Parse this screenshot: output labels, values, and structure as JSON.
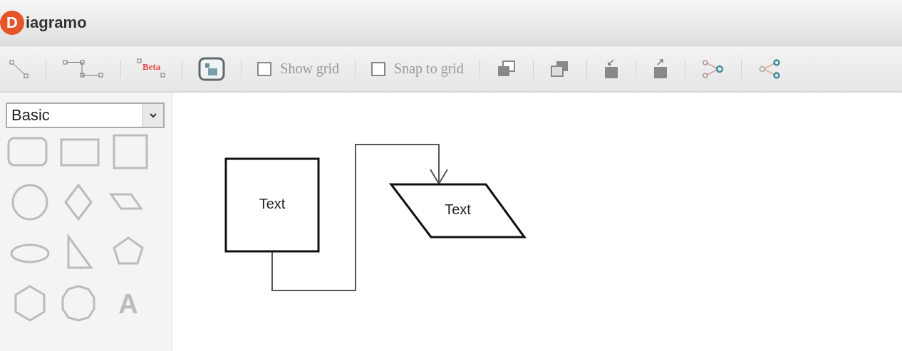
{
  "logo": {
    "initial": "D",
    "rest": "iagramo"
  },
  "toolbar": [
    {
      "kind": "straight-connector"
    },
    {
      "kind": "jagged-connector"
    },
    {
      "kind": "curved-connector",
      "badge": "Beta"
    },
    {
      "kind": "container"
    },
    {
      "kind": "checkbox",
      "label": "Show grid",
      "checked": false
    },
    {
      "kind": "checkbox",
      "label": "Snap to grid",
      "checked": false
    },
    {
      "kind": "to-front"
    },
    {
      "kind": "to-back"
    },
    {
      "kind": "move-down"
    },
    {
      "kind": "move-up"
    },
    {
      "kind": "group"
    },
    {
      "kind": "share"
    }
  ],
  "sidebar": {
    "set_select": {
      "value": "Basic"
    },
    "shapes": [
      {
        "kind": "rounded-rectangle"
      },
      {
        "kind": "rectangle"
      },
      {
        "kind": "square"
      },
      {
        "kind": "circle"
      },
      {
        "kind": "diamond"
      },
      {
        "kind": "parallelogram"
      },
      {
        "kind": "ellipse"
      },
      {
        "kind": "right-triangle"
      },
      {
        "kind": "pentagon"
      },
      {
        "kind": "hexagon"
      },
      {
        "kind": "octagon"
      },
      {
        "kind": "text",
        "label": "A"
      }
    ]
  },
  "canvas": {
    "figures": [
      {
        "kind": "square",
        "text": "Text"
      },
      {
        "kind": "parallelogram",
        "text": "Text"
      }
    ]
  }
}
